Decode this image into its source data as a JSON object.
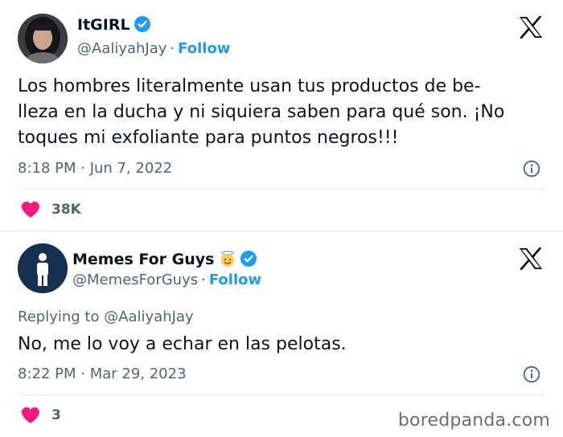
{
  "tweets": [
    {
      "name": "ItGIRL",
      "handle": "@AaliyahJay",
      "separator": "·",
      "follow_label": "Follow",
      "text_lines": [
        "Los hombres literalmente usan tus productos de be-",
        "lleza en la ducha y ni siquiera saben para qué son. ¡No",
        "toques mi exfoliante para puntos negros!!!"
      ],
      "timestamp": "8:18 PM · Jun 7, 2022",
      "likes": "38K",
      "icons": {
        "avatar": "profile-photo",
        "badge": "verified-badge-icon",
        "logo": "x-logo-icon",
        "info": "info-icon",
        "like": "heart-icon"
      }
    },
    {
      "name": "Memes For Guys",
      "handle": "@MemesForGuys",
      "separator": "·",
      "follow_label": "Follow",
      "replying_to": "Replying to @AaliyahJay",
      "text_lines": [
        "No, me lo voy a echar en las pelotas."
      ],
      "timestamp": "8:22 PM · Mar 29, 2023",
      "likes": "3",
      "icons": {
        "avatar": "man-figure-avatar",
        "emoji": "angel-emoji-icon",
        "badge": "verified-badge-icon",
        "logo": "x-logo-icon",
        "info": "info-icon",
        "like": "heart-icon"
      }
    }
  ],
  "watermark": "boredpanda.com",
  "colors": {
    "verified": "#1d9bf0",
    "follow": "#1d9bf0",
    "heart": "#f91880",
    "secondary_text": "#536471",
    "primary_text": "#0f1419"
  }
}
